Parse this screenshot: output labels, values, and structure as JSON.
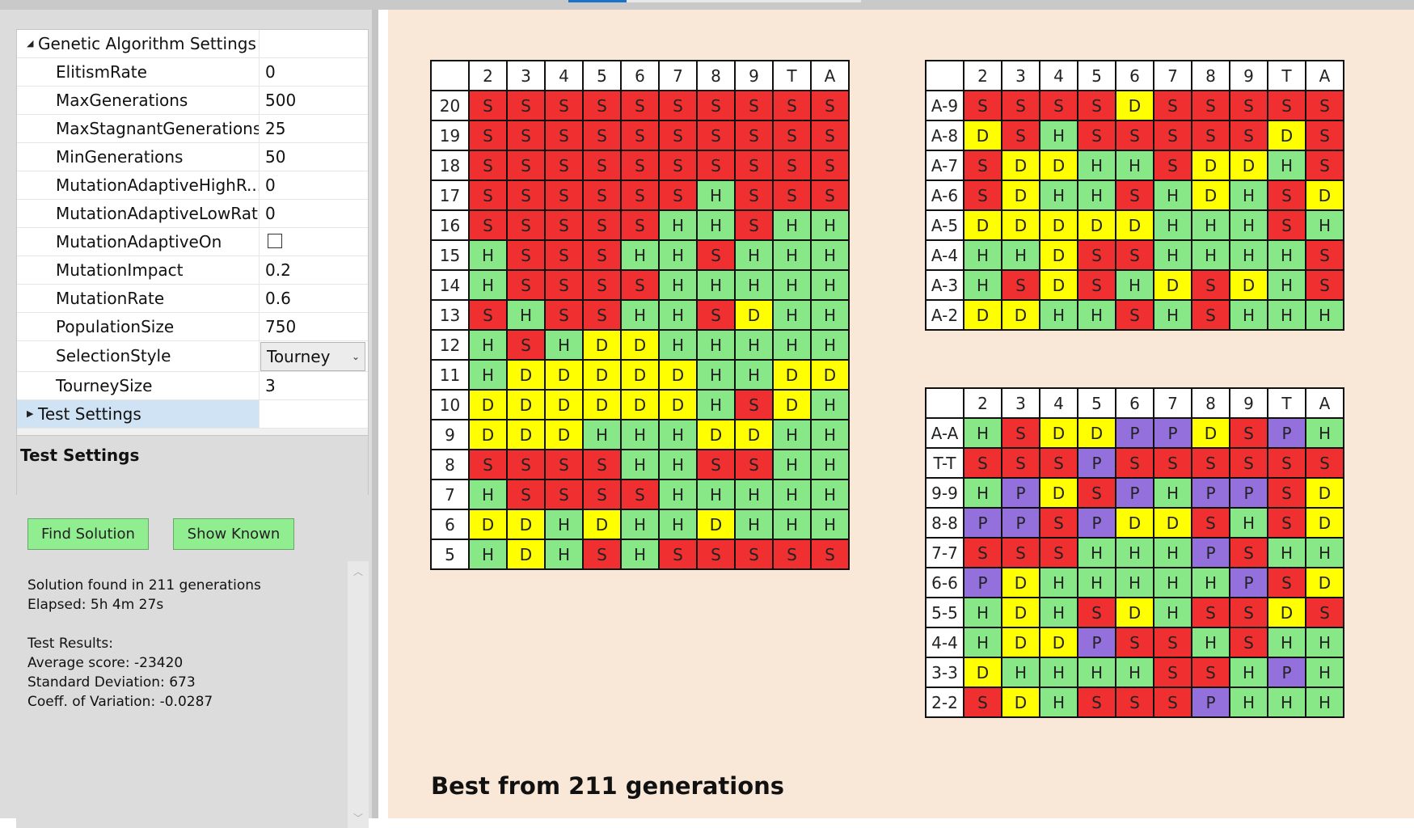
{
  "properties": {
    "category_genetic": "Genetic Algorithm Settings",
    "rows": [
      {
        "name": "ElitismRate",
        "value": "0"
      },
      {
        "name": "MaxGenerations",
        "value": "500"
      },
      {
        "name": "MaxStagnantGenerations",
        "value": "25"
      },
      {
        "name": "MinGenerations",
        "value": "50"
      },
      {
        "name": "MutationAdaptiveHighR...",
        "value": "0"
      },
      {
        "name": "MutationAdaptiveLowRate",
        "value": "0"
      },
      {
        "name": "MutationAdaptiveOn",
        "value": ""
      },
      {
        "name": "MutationImpact",
        "value": "0.2"
      },
      {
        "name": "MutationRate",
        "value": "0.6"
      },
      {
        "name": "PopulationSize",
        "value": "750"
      },
      {
        "name": "SelectionStyle",
        "value": "Tourney"
      },
      {
        "name": "TourneySize",
        "value": "3"
      }
    ],
    "category_test": "Test Settings",
    "description_title": "Test Settings"
  },
  "buttons": {
    "find_solution": "Find Solution",
    "show_known": "Show Known"
  },
  "results": {
    "line1": "Solution found in 211 generations",
    "line2": "Elapsed: 5h 4m 27s",
    "line3": "Test Results:",
    "line4": "Average score: -23420",
    "line5": "Standard Deviation: 673",
    "line6": "Coeff. of Variation: -0.0287"
  },
  "colors": {
    "S": "#f03030",
    "H": "#88e888",
    "D": "#ffff00",
    "P": "#9370db"
  },
  "dealer_cards": [
    "2",
    "3",
    "4",
    "5",
    "6",
    "7",
    "8",
    "9",
    "T",
    "A"
  ],
  "hard_table": {
    "rows": [
      {
        "label": "20",
        "cells": [
          "S",
          "S",
          "S",
          "S",
          "S",
          "S",
          "S",
          "S",
          "S",
          "S"
        ]
      },
      {
        "label": "19",
        "cells": [
          "S",
          "S",
          "S",
          "S",
          "S",
          "S",
          "S",
          "S",
          "S",
          "S"
        ]
      },
      {
        "label": "18",
        "cells": [
          "S",
          "S",
          "S",
          "S",
          "S",
          "S",
          "S",
          "S",
          "S",
          "S"
        ]
      },
      {
        "label": "17",
        "cells": [
          "S",
          "S",
          "S",
          "S",
          "S",
          "S",
          "H",
          "S",
          "S",
          "S"
        ]
      },
      {
        "label": "16",
        "cells": [
          "S",
          "S",
          "S",
          "S",
          "S",
          "H",
          "H",
          "S",
          "H",
          "H"
        ]
      },
      {
        "label": "15",
        "cells": [
          "H",
          "S",
          "S",
          "S",
          "H",
          "H",
          "S",
          "H",
          "H",
          "H"
        ]
      },
      {
        "label": "14",
        "cells": [
          "H",
          "S",
          "S",
          "S",
          "S",
          "H",
          "H",
          "H",
          "H",
          "H"
        ]
      },
      {
        "label": "13",
        "cells": [
          "S",
          "H",
          "S",
          "S",
          "H",
          "H",
          "S",
          "D",
          "H",
          "H"
        ]
      },
      {
        "label": "12",
        "cells": [
          "H",
          "S",
          "H",
          "D",
          "D",
          "H",
          "H",
          "H",
          "H",
          "H"
        ]
      },
      {
        "label": "11",
        "cells": [
          "H",
          "D",
          "D",
          "D",
          "D",
          "D",
          "H",
          "H",
          "D",
          "D"
        ]
      },
      {
        "label": "10",
        "cells": [
          "D",
          "D",
          "D",
          "D",
          "D",
          "D",
          "H",
          "S",
          "D",
          "H"
        ]
      },
      {
        "label": "9",
        "cells": [
          "D",
          "D",
          "D",
          "H",
          "H",
          "H",
          "D",
          "D",
          "H",
          "H"
        ]
      },
      {
        "label": "8",
        "cells": [
          "S",
          "S",
          "S",
          "S",
          "H",
          "H",
          "S",
          "S",
          "H",
          "H"
        ]
      },
      {
        "label": "7",
        "cells": [
          "H",
          "S",
          "S",
          "S",
          "S",
          "H",
          "H",
          "H",
          "H",
          "H"
        ]
      },
      {
        "label": "6",
        "cells": [
          "D",
          "D",
          "H",
          "D",
          "H",
          "H",
          "D",
          "H",
          "H",
          "H"
        ]
      },
      {
        "label": "5",
        "cells": [
          "H",
          "D",
          "H",
          "S",
          "H",
          "S",
          "S",
          "S",
          "S",
          "S"
        ]
      }
    ]
  },
  "soft_table": {
    "rows": [
      {
        "label": "A-9",
        "cells": [
          "S",
          "S",
          "S",
          "S",
          "D",
          "S",
          "S",
          "S",
          "S",
          "S"
        ]
      },
      {
        "label": "A-8",
        "cells": [
          "D",
          "S",
          "H",
          "S",
          "S",
          "S",
          "S",
          "S",
          "D",
          "S"
        ]
      },
      {
        "label": "A-7",
        "cells": [
          "S",
          "D",
          "D",
          "H",
          "H",
          "S",
          "D",
          "D",
          "H",
          "S"
        ]
      },
      {
        "label": "A-6",
        "cells": [
          "S",
          "D",
          "H",
          "H",
          "S",
          "H",
          "D",
          "H",
          "S",
          "D"
        ]
      },
      {
        "label": "A-5",
        "cells": [
          "D",
          "D",
          "D",
          "D",
          "D",
          "H",
          "H",
          "H",
          "S",
          "H"
        ]
      },
      {
        "label": "A-4",
        "cells": [
          "H",
          "H",
          "D",
          "S",
          "S",
          "H",
          "H",
          "H",
          "H",
          "S"
        ]
      },
      {
        "label": "A-3",
        "cells": [
          "H",
          "S",
          "D",
          "S",
          "H",
          "D",
          "S",
          "D",
          "H",
          "S"
        ]
      },
      {
        "label": "A-2",
        "cells": [
          "D",
          "D",
          "H",
          "H",
          "S",
          "H",
          "S",
          "H",
          "H",
          "H"
        ]
      }
    ]
  },
  "pairs_table": {
    "rows": [
      {
        "label": "A-A",
        "cells": [
          "H",
          "S",
          "D",
          "D",
          "P",
          "P",
          "D",
          "S",
          "P",
          "H"
        ]
      },
      {
        "label": "T-T",
        "cells": [
          "S",
          "S",
          "S",
          "P",
          "S",
          "S",
          "S",
          "S",
          "S",
          "S"
        ]
      },
      {
        "label": "9-9",
        "cells": [
          "H",
          "P",
          "D",
          "S",
          "P",
          "H",
          "P",
          "P",
          "S",
          "D"
        ]
      },
      {
        "label": "8-8",
        "cells": [
          "P",
          "P",
          "S",
          "P",
          "D",
          "D",
          "S",
          "H",
          "S",
          "D"
        ]
      },
      {
        "label": "7-7",
        "cells": [
          "S",
          "S",
          "S",
          "H",
          "H",
          "H",
          "P",
          "S",
          "H",
          "H"
        ]
      },
      {
        "label": "6-6",
        "cells": [
          "P",
          "D",
          "H",
          "H",
          "H",
          "H",
          "H",
          "P",
          "S",
          "D"
        ]
      },
      {
        "label": "5-5",
        "cells": [
          "H",
          "D",
          "H",
          "S",
          "D",
          "H",
          "S",
          "S",
          "D",
          "S"
        ]
      },
      {
        "label": "4-4",
        "cells": [
          "H",
          "D",
          "D",
          "P",
          "S",
          "S",
          "H",
          "S",
          "H",
          "H"
        ]
      },
      {
        "label": "3-3",
        "cells": [
          "D",
          "H",
          "H",
          "H",
          "H",
          "S",
          "S",
          "H",
          "P",
          "H"
        ]
      },
      {
        "label": "2-2",
        "cells": [
          "S",
          "D",
          "H",
          "S",
          "S",
          "S",
          "P",
          "H",
          "H",
          "H"
        ]
      }
    ]
  },
  "caption": "Best from 211 generations"
}
